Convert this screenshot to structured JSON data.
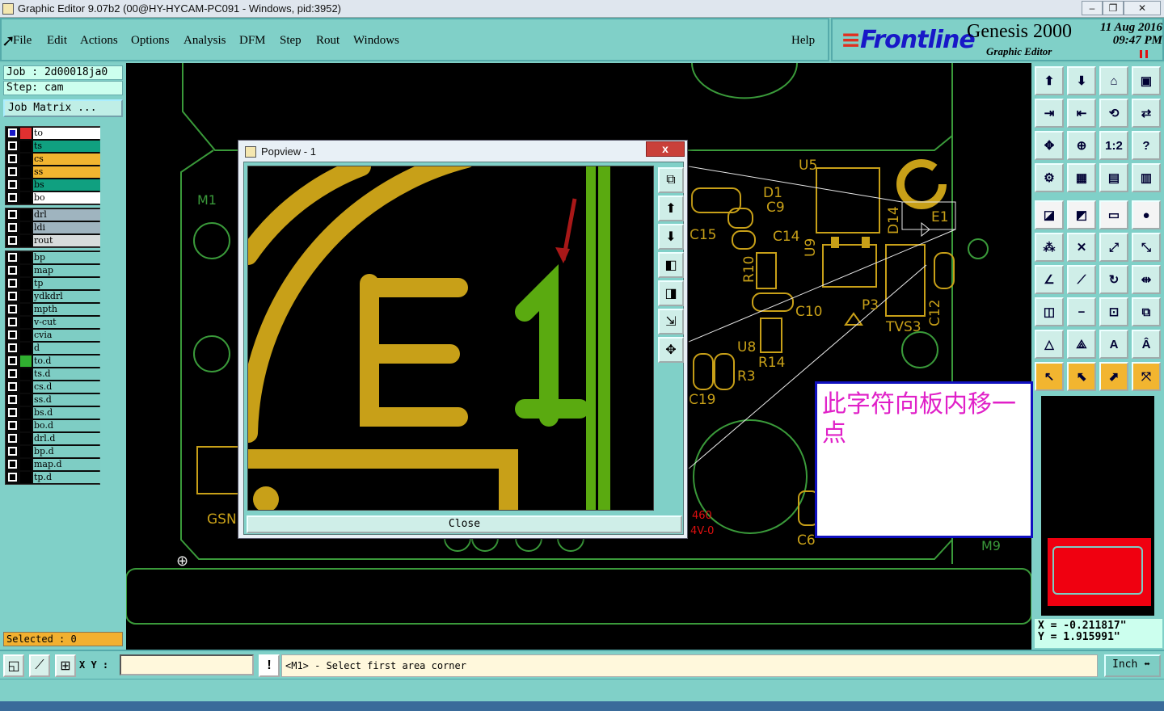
{
  "window": {
    "title": "Graphic Editor 9.07b2 (00@HY-HYCAM-PC091 - Windows, pid:3952)"
  },
  "menu": {
    "items": [
      "File",
      "Edit",
      "Actions",
      "Options",
      "Analysis",
      "DFM",
      "Step",
      "Rout",
      "Windows"
    ],
    "help": "Help"
  },
  "brand": {
    "logo": "Frontline",
    "product": "Genesis 2000",
    "subtitle": "Graphic Editor",
    "date": "11 Aug 2016",
    "time": "09:47 PM"
  },
  "job": {
    "job_line": "Job : 2d00018ja0",
    "step_line": "Step: cam",
    "matrix_button": "Job Matrix ..."
  },
  "layers": {
    "group1": [
      {
        "name": "to",
        "color": "#ffffff",
        "swatch": "#e03030"
      },
      {
        "name": "ts",
        "color": "#10a080",
        "swatch": "#000000"
      },
      {
        "name": "cs",
        "color": "#f2b530",
        "swatch": "#000000"
      },
      {
        "name": "ss",
        "color": "#f2b530",
        "swatch": "#000000"
      },
      {
        "name": "bs",
        "color": "#10a080",
        "swatch": "#000000"
      },
      {
        "name": "bo",
        "color": "#ffffff",
        "swatch": "#000000"
      }
    ],
    "group2": [
      {
        "name": "drl",
        "color": "#9fb4bf",
        "swatch": "#000000"
      },
      {
        "name": "ldi",
        "color": "#9fb4bf",
        "swatch": "#000000"
      },
      {
        "name": "rout",
        "color": "#d8dcdc",
        "swatch": "#000000"
      }
    ],
    "group3": [
      {
        "name": "bp",
        "color": "#7ecdc4",
        "swatch": "#000000"
      },
      {
        "name": "map",
        "color": "#7ecdc4",
        "swatch": "#000000"
      },
      {
        "name": "tp",
        "color": "#7ecdc4",
        "swatch": "#000000"
      },
      {
        "name": "ydkdrl",
        "color": "#7ecdc4",
        "swatch": "#000000"
      },
      {
        "name": "mpth",
        "color": "#7ecdc4",
        "swatch": "#000000"
      },
      {
        "name": "v-cut",
        "color": "#7ecdc4",
        "swatch": "#000000"
      },
      {
        "name": "cvia",
        "color": "#7ecdc4",
        "swatch": "#000000"
      },
      {
        "name": "d",
        "color": "#7ecdc4",
        "swatch": "#000000"
      },
      {
        "name": "to.d",
        "color": "#7ecdc4",
        "swatch": "#30b030"
      },
      {
        "name": "ts.d",
        "color": "#7ecdc4",
        "swatch": "#000000"
      },
      {
        "name": "cs.d",
        "color": "#7ecdc4",
        "swatch": "#000000"
      },
      {
        "name": "ss.d",
        "color": "#7ecdc4",
        "swatch": "#000000"
      },
      {
        "name": "bs.d",
        "color": "#7ecdc4",
        "swatch": "#000000"
      },
      {
        "name": "bo.d",
        "color": "#7ecdc4",
        "swatch": "#000000"
      },
      {
        "name": "drl.d",
        "color": "#7ecdc4",
        "swatch": "#000000"
      },
      {
        "name": "bp.d",
        "color": "#7ecdc4",
        "swatch": "#000000"
      },
      {
        "name": "map.d",
        "color": "#7ecdc4",
        "swatch": "#000000"
      },
      {
        "name": "tp.d",
        "color": "#7ecdc4",
        "swatch": "#000000"
      }
    ]
  },
  "selected": "Selected : 0",
  "popup": {
    "title": "Popview - 1",
    "close_x": "x",
    "close_button": "Close"
  },
  "pcb_labels": {
    "m1": "M1",
    "u5": "U5",
    "d1": "D1",
    "c9": "C9",
    "c15": "C15",
    "c14": "C14",
    "d14": "D14",
    "e1": "E1",
    "r10": "R10",
    "u9": "U9",
    "c10": "C10",
    "p3": "P3",
    "tvs3": "TVS3",
    "c12": "C12",
    "u8": "U8",
    "r14": "R14",
    "r3": "R3",
    "c19": "C19",
    "gsn": "GSN",
    "n460": "460",
    "v0": "4V-0",
    "m9": "M9",
    "c6": "C6"
  },
  "note": "此字符向板内移一点",
  "coords": {
    "x": "X = -0.211817\"",
    "y": "Y = 1.915991\""
  },
  "status": {
    "xy_label": "X Y :",
    "xy_value": "",
    "warn": "!",
    "message": "<M1> - Select first area corner",
    "units": "Inch"
  },
  "colors": {
    "silk": "#c8a018",
    "green": "#5aaa10",
    "outline": "#3a9a3a",
    "accent": "#e01010"
  }
}
